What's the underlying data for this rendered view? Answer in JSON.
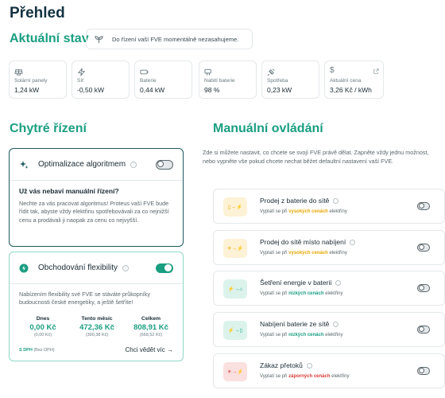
{
  "page_title": "Přehled",
  "status": {
    "title": "Aktuální stav",
    "note": "Do řízení vaší FVE momentálně nezasahujeme.",
    "note_icon": "sprout-icon"
  },
  "metrics": [
    {
      "label": "Solární panely",
      "value": "1,24 kW",
      "icon": "solar-panel-icon"
    },
    {
      "label": "Síť",
      "value": "-0,50 kW",
      "icon": "lightning-icon"
    },
    {
      "label": "Baterie",
      "value": "0,44 kW",
      "icon": "battery-icon"
    },
    {
      "label": "Nabití baterie",
      "value": "98 %",
      "icon": "battery-charge-icon"
    },
    {
      "label": "Spotřeba",
      "value": "0,23 kW",
      "icon": "plug-icon"
    },
    {
      "label": "Aktuální cena",
      "value": "3,26 Kč / kWh",
      "icon": "dollar-icon"
    }
  ],
  "smart": {
    "title": "Chytré řízení",
    "optimization": {
      "title": "Optimalizace algoritmem",
      "enabled": false,
      "question": "Už vás nebaví manuální řízení?",
      "description": "Nechte za vás pracovat algoritmus! Proteus vaší FVE bude řídit tak, abyste vždy elektřinu spotřebovávali za co nejnižší cenu a prodávali ji naopak za cenu co nejvyšší."
    },
    "flexibility": {
      "title": "Obchodování flexibility",
      "enabled": true,
      "description": "Nabízením flexibility své FVE se stáváte průkopníky budoucnosti české energetiky, a ještě šetříte!",
      "stats": [
        {
          "label": "Dnes",
          "value": "0,00 Kč",
          "sub": "(0,00 Kč)"
        },
        {
          "label": "Tento měsíc",
          "value": "472,36 Kč",
          "sub": "(390,38 Kč)"
        },
        {
          "label": "Celkem",
          "value": "808,91 Kč",
          "sub": "(668,52 Kč)"
        }
      ],
      "footnote_strong": "S DPH",
      "footnote_rest": " (Bez DPH)",
      "link": "Chci vědět víc →"
    }
  },
  "manual": {
    "title": "Manuální ovládání",
    "intro": "Zde si můžete nastavit, co chcete se svojí FVE právě dělat. Zapněte vždy jednu možnost, nebo vypněte vše pokud chcete nechat běžet defaultní nastavení vaší FVE.",
    "rows": [
      {
        "title": "Prodej z baterie do sítě",
        "sub_before": "Vyplatí se při ",
        "sub_strong": "vysokých cenách",
        "sub_after": " elektřiny",
        "strong_color": "#e6a700",
        "badge_bg": "#fdf2d6",
        "badge_color": "#e6a700",
        "badge_glyph": "▯→⚡",
        "icon": "battery-to-grid-icon"
      },
      {
        "title": "Prodej do sítě místo nabíjení",
        "sub_before": "Vyplatí se při ",
        "sub_strong": "vysokých cenách",
        "sub_after": " elektřiny",
        "strong_color": "#e6a700",
        "badge_bg": "#fdf2d6",
        "badge_color": "#e6a700",
        "badge_glyph": "☀→⚡",
        "icon": "solar-to-grid-icon"
      },
      {
        "title": "Šetření energie v baterii",
        "sub_before": "Vyplatí se při ",
        "sub_strong": "nízkých cenách",
        "sub_after": " elektřiny",
        "strong_color": "#1a9e82",
        "badge_bg": "#dcf3ec",
        "badge_color": "#1a9e82",
        "badge_glyph": "⚡→⌂",
        "icon": "grid-to-house-icon"
      },
      {
        "title": "Nabíjení baterie ze sítě",
        "sub_before": "Vyplatí se při ",
        "sub_strong": "nízkých cenách",
        "sub_after": " elektřiny",
        "strong_color": "#1a9e82",
        "badge_bg": "#dcf3ec",
        "badge_color": "#1a9e82",
        "badge_glyph": "⚡→▯",
        "icon": "grid-to-battery-icon"
      },
      {
        "title": "Zákaz přetoků",
        "sub_before": "Vyplatí se při ",
        "sub_strong": "záporných cenách",
        "sub_after": " elektřiny",
        "strong_color": "#d93a3a",
        "badge_bg": "#fbe0e0",
        "badge_color": "#d93a3a",
        "badge_glyph": "☀→⚡",
        "icon": "no-overflow-icon"
      }
    ]
  }
}
